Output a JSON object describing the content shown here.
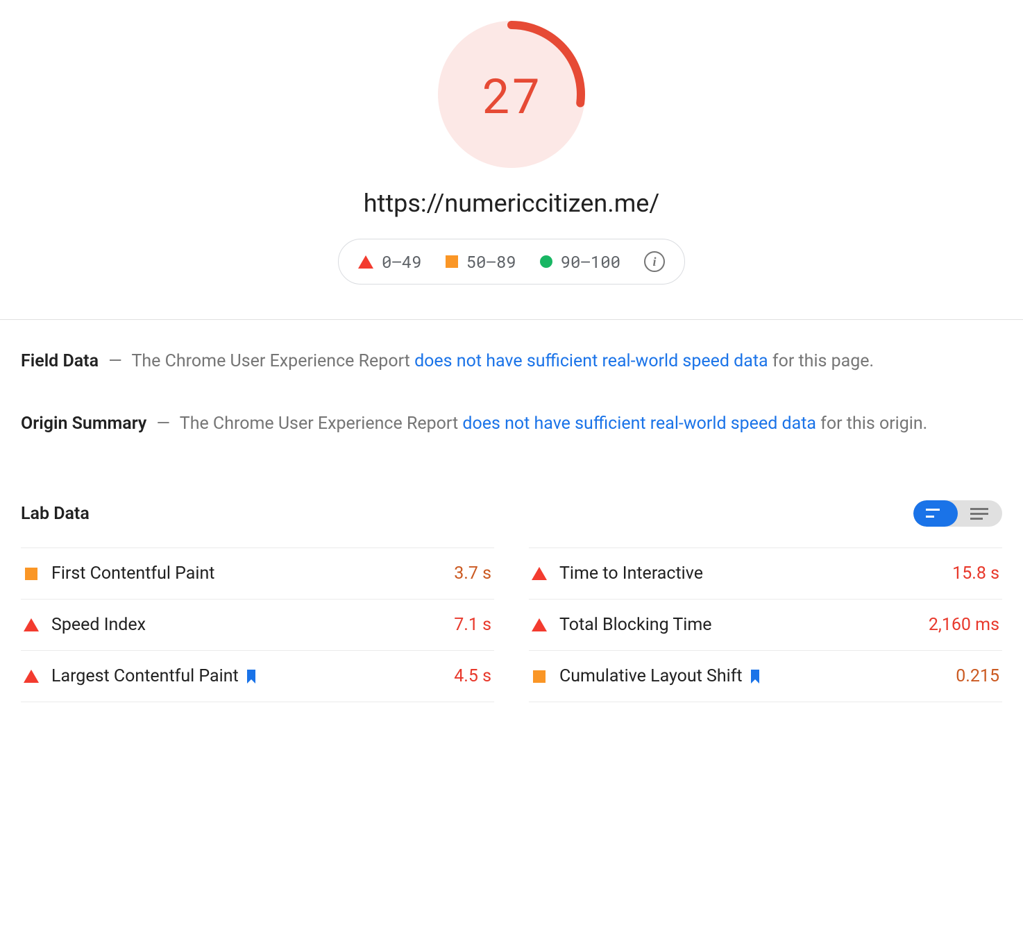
{
  "gauge": {
    "score": "27",
    "percent": 27,
    "color": "#e64a35",
    "bg": "#fce8e6"
  },
  "url": "https://numericcitizen.me/",
  "legend": {
    "range1": "0–49",
    "range2": "50–89",
    "range3": "90–100"
  },
  "field_data": {
    "title": "Field Data",
    "pre": "The Chrome User Experience Report ",
    "link": "does not have sufficient real-world speed data",
    "post": " for this page."
  },
  "origin_summary": {
    "title": "Origin Summary",
    "pre": "The Chrome User Experience Report ",
    "link": "does not have sufficient real-world speed data",
    "post": " for this origin."
  },
  "lab": {
    "title": "Lab Data"
  },
  "metrics": {
    "left": [
      {
        "label": "First Contentful Paint",
        "value": "3.7 s",
        "status": "square",
        "value_class": "value-orange",
        "bookmark": false
      },
      {
        "label": "Speed Index",
        "value": "7.1 s",
        "status": "triangle",
        "value_class": "value-red",
        "bookmark": false
      },
      {
        "label": "Largest Contentful Paint",
        "value": "4.5 s",
        "status": "triangle",
        "value_class": "value-red",
        "bookmark": true
      }
    ],
    "right": [
      {
        "label": "Time to Interactive",
        "value": "15.8 s",
        "status": "triangle",
        "value_class": "value-red",
        "bookmark": false
      },
      {
        "label": "Total Blocking Time",
        "value": "2,160 ms",
        "status": "triangle",
        "value_class": "value-red",
        "bookmark": false
      },
      {
        "label": "Cumulative Layout Shift",
        "value": "0.215",
        "status": "square",
        "value_class": "value-orange",
        "bookmark": true
      }
    ]
  }
}
